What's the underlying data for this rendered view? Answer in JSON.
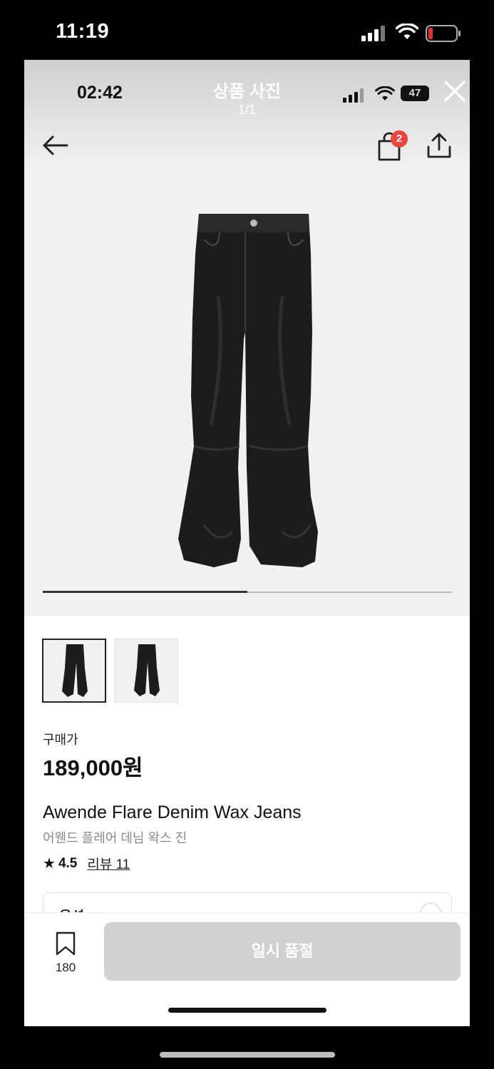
{
  "outer_status": {
    "time": "11:19"
  },
  "inner_status": {
    "time": "02:42",
    "battery": "47"
  },
  "photo_viewer": {
    "title": "상품 사진",
    "counter": "1/1",
    "slider_progress": 0.5
  },
  "header": {
    "cart_count": "2"
  },
  "icons": [
    "back-arrow-icon",
    "shopping-bag-icon",
    "share-icon",
    "close-icon",
    "bookmark-icon",
    "star-icon"
  ],
  "product": {
    "price_label": "구매가",
    "price": "189,000원",
    "name_en": "Awende Flare Denim Wax Jeans",
    "name_ko": "어웬드 플레어 데님 왁스 진",
    "star": "★",
    "rating": "4.5",
    "review_link": "리뷰 11"
  },
  "option": {
    "label": "옵션"
  },
  "bottom_bar": {
    "bookmark_count": "180",
    "cta_label": "일시 품절"
  },
  "colors": {
    "badge": "#e8473e",
    "cta_disabled": "#d1d1d1",
    "photo_bg": "#f1f1f1"
  }
}
